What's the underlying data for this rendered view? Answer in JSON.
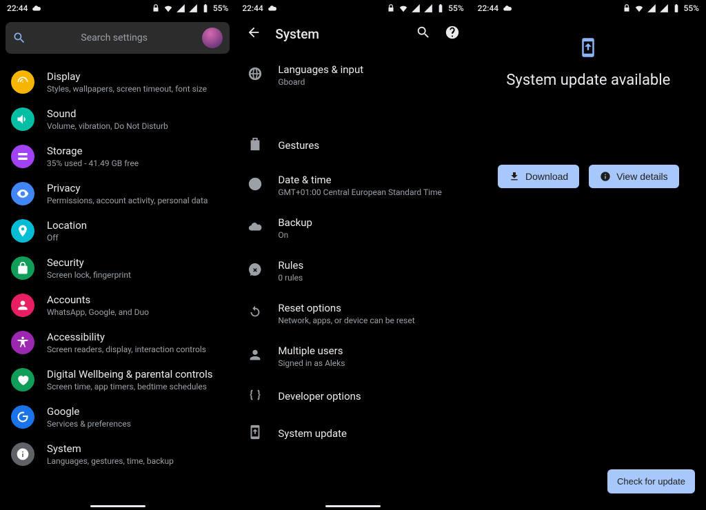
{
  "status": {
    "time": "22:44",
    "battery": "55%"
  },
  "pane1": {
    "search_placeholder": "Search settings",
    "items": [
      {
        "title": "Display",
        "subtitle": "Styles, wallpapers, screen timeout, font size",
        "color": "#f7b500",
        "icon": "display"
      },
      {
        "title": "Sound",
        "subtitle": "Volume, vibration, Do Not Disturb",
        "color": "#00bfa5",
        "icon": "sound"
      },
      {
        "title": "Storage",
        "subtitle": "35% used - 41.49 GB free",
        "color": "#a142f4",
        "icon": "storage"
      },
      {
        "title": "Privacy",
        "subtitle": "Permissions, account activity, personal data",
        "color": "#4285f4",
        "icon": "privacy"
      },
      {
        "title": "Location",
        "subtitle": "Off",
        "color": "#00bcd4",
        "icon": "location"
      },
      {
        "title": "Security",
        "subtitle": "Screen lock, fingerprint",
        "color": "#0f9d58",
        "icon": "security"
      },
      {
        "title": "Accounts",
        "subtitle": "WhatsApp, Google, and Duo",
        "color": "#e91e63",
        "icon": "accounts"
      },
      {
        "title": "Accessibility",
        "subtitle": "Screen readers, display, interaction controls",
        "color": "#9c27b0",
        "icon": "accessibility"
      },
      {
        "title": "Digital Wellbeing & parental controls",
        "subtitle": "Screen time, app timers, bedtime schedules",
        "color": "#0f9d58",
        "icon": "wellbeing"
      },
      {
        "title": "Google",
        "subtitle": "Services & preferences",
        "color": "#1a73e8",
        "icon": "google"
      },
      {
        "title": "System",
        "subtitle": "Languages, gestures, time, backup",
        "color": "#5f6368",
        "icon": "system"
      }
    ]
  },
  "pane2": {
    "title": "System",
    "items": [
      {
        "title": "Languages & input",
        "subtitle": "Gboard",
        "icon": "language",
        "gap": true
      },
      {
        "title": "Gestures",
        "subtitle": "",
        "icon": "gestures"
      },
      {
        "title": "Date & time",
        "subtitle": "GMT+01:00 Central European Standard Time",
        "icon": "clock"
      },
      {
        "title": "Backup",
        "subtitle": "On",
        "icon": "cloud"
      },
      {
        "title": "Rules",
        "subtitle": "0 rules",
        "icon": "rules"
      },
      {
        "title": "Reset options",
        "subtitle": "Network, apps, or device can be reset",
        "icon": "reset"
      },
      {
        "title": "Multiple users",
        "subtitle": "Signed in as Aleks",
        "icon": "user"
      },
      {
        "title": "Developer options",
        "subtitle": "",
        "icon": "braces"
      },
      {
        "title": "System update",
        "subtitle": "",
        "icon": "update"
      }
    ]
  },
  "pane3": {
    "title": "System update available",
    "download": "Download",
    "details": "View details",
    "check": "Check for update"
  }
}
